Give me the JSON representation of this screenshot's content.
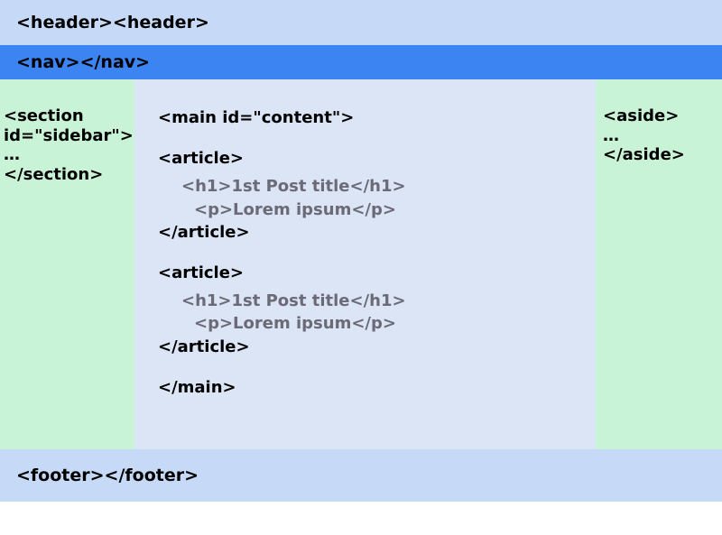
{
  "header": {
    "text": "<header><header>"
  },
  "nav": {
    "text": "<nav></nav>"
  },
  "sidebar": {
    "open": "<section id=\"sidebar\">",
    "dots": "…",
    "close": "</section>"
  },
  "main": {
    "open": "<main id=\"content\">",
    "close": "</main>",
    "articles": [
      {
        "open": "<article>",
        "h1": "<h1>1st Post title</h1>",
        "p": "<p>Lorem ipsum</p>",
        "close": "</article>"
      },
      {
        "open": "<article>",
        "h1": "<h1>1st Post title</h1>",
        "p": "<p>Lorem ipsum</p>",
        "close": "</article>"
      }
    ]
  },
  "aside": {
    "open": "<aside>",
    "dots": "…",
    "close": "</aside>"
  },
  "footer": {
    "text": "<footer></footer>"
  }
}
